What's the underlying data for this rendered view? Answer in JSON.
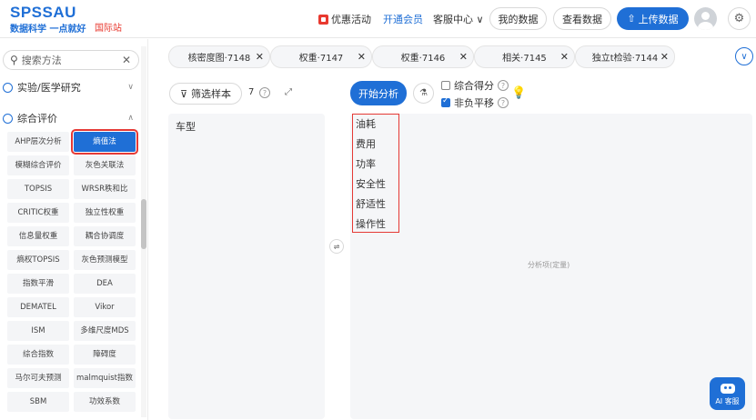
{
  "header": {
    "logo": "SPSSAU",
    "slogan": "数据科学 一点就好",
    "intl": "国际站",
    "promo": "优惠活动",
    "vip": "开通会员",
    "service": "客服中心",
    "service_chevron": "∨",
    "my_data": "我的数据",
    "view_data": "查看数据",
    "upload": "上传数据",
    "upload_icon": "⇧",
    "gear_icon": "⚙"
  },
  "sidebar": {
    "search_placeholder": "搜索方法",
    "search_icon": "⚲",
    "clear_icon": "✕",
    "cat1": "实验/医学研究",
    "cat1_chevron": "∨",
    "cat2": "综合评价",
    "cat2_chevron": "∧",
    "methods": [
      "AHP层次分析",
      "熵值法",
      "模糊综合评价",
      "灰色关联法",
      "TOPSIS",
      "WRSR秩和比",
      "CRITIC权重",
      "独立性权重",
      "信息量权重",
      "耦合协调度",
      "熵权TOPSIS",
      "灰色预测模型",
      "指数平滑",
      "DEA",
      "DEMATEL",
      "Vikor",
      "ISM",
      "多维尺度MDS",
      "综合指数",
      "障碍度",
      "马尔可夫预测",
      "malmquist指数",
      "SBM",
      "功效系数"
    ],
    "active_index": 1
  },
  "tabs": [
    {
      "label": "核密度图·7148",
      "close": "✕"
    },
    {
      "label": "权重·7147",
      "close": "✕"
    },
    {
      "label": "权重·7146",
      "close": "✕"
    },
    {
      "label": "相关·7145",
      "close": "✕"
    },
    {
      "label": "独立t检验·7144",
      "close": "✕"
    }
  ],
  "tabs_toggle": "∨",
  "left_panel": {
    "filter_label": "筛选样本",
    "filter_icon": "⊽",
    "sample_count": "7",
    "help": "?",
    "expand_icon": "⤢",
    "variables": [
      "车型"
    ]
  },
  "swap_icon": "⇌",
  "right_panel": {
    "start_label": "开始分析",
    "flask_icon": "⚗",
    "option1": "综合得分",
    "option1_checked": false,
    "option2": "非负平移",
    "option2_checked": true,
    "help": "?",
    "bulb_icon": "💡",
    "items": [
      "油耗",
      "费用",
      "功率",
      "安全性",
      "舒适性",
      "操作性"
    ],
    "placeholder": "分析项(定量)"
  },
  "ai_service": "AI 客服",
  "colors": {
    "primary": "#1f6fd6",
    "highlight": "#e53935",
    "intl": "#e8392f"
  }
}
